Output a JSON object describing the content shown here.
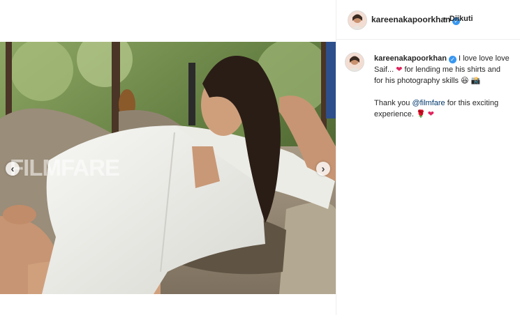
{
  "post": {
    "watermark": "FILMFARE",
    "prev_icon": "chevron-left-icon",
    "next_icon": "chevron-right-icon"
  },
  "header": {
    "username": "kareenakapoorkhan",
    "separator": "•",
    "follow_label": "Diikuti"
  },
  "caption": {
    "username": "kareenakapoorkhan",
    "line1_a": "I love love love Saif...",
    "line1_b": "for lending me his shirts and for his photography skills",
    "line2_a": "Thank you",
    "mention": "@filmfare",
    "line2_b": "for this exciting experience."
  },
  "colors": {
    "accent_link": "#00376b",
    "verified_blue": "#3897f0",
    "heart_red": "#e0245e"
  }
}
